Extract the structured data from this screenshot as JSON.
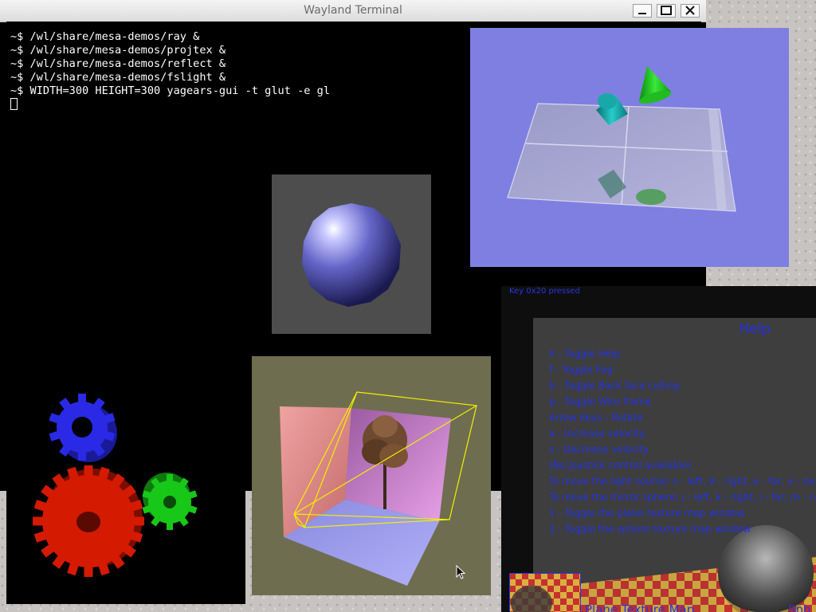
{
  "terminal": {
    "title": "Wayland Terminal",
    "lines": [
      "~$ /wl/share/mesa-demos/ray &",
      "~$ /wl/share/mesa-demos/projtex &",
      "~$ /wl/share/mesa-demos/reflect &",
      "~$ /wl/share/mesa-demos/fslight &",
      "~$ WIDTH=300 HEIGHT=300 yagears-gui -t glut -e gl"
    ],
    "controls": {
      "minimize": "minimize-icon",
      "maximize": "maximize-icon",
      "close": "close-icon"
    }
  },
  "help_window": {
    "status": "Key 0x20 pressed",
    "title": "Help",
    "items": [
      "h - Toggle Help",
      "f - Toggle Fog",
      "b - Toggle Back face culling",
      "p - Toggle Wire frame",
      "Arrow Keys - Rotate",
      "a - Increase velocity",
      "z - Decrease velocity",
      "(No Joystick control available)",
      "To move the light source: s - left, d - right, e - far, x - nea",
      "To move the mirror sphere: j - left, k - right, i - far, m - nea",
      "1 - Toggle the plane texture map window",
      "2 - Toggle the sphere texture map window"
    ],
    "bottom_labels": [
      "Plane Texture Map",
      "Sph"
    ]
  },
  "colors": {
    "terminal_bg": "#000000",
    "projtex_bg": "#7f7fe2",
    "help_text": "#2433e6",
    "gear_blue": "#2a2ae6",
    "gear_red": "#d41a00",
    "gear_green": "#18c818"
  }
}
